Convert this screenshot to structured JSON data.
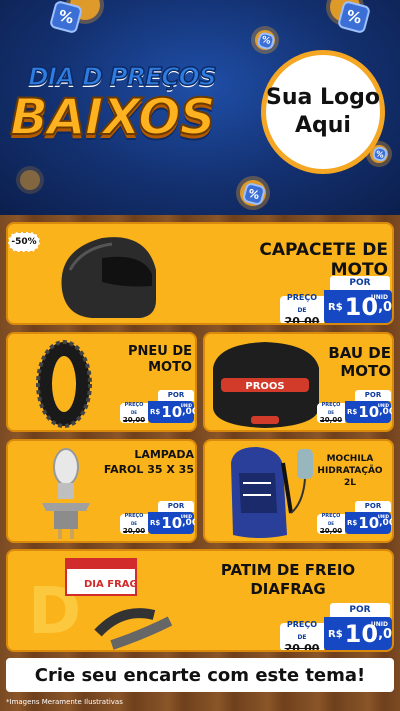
{
  "header": {
    "title_top": "DIA D PREÇOS",
    "title_main": "BAIXOS",
    "logo_line1": "Sua Logo",
    "logo_line2": "Aqui",
    "percent_symbol": "%"
  },
  "discount_badge": "-50%",
  "products": [
    {
      "name": "CAPACETE DE MOTO",
      "por": "POR",
      "preco_label": "PREÇO",
      "de_label": "DE",
      "old_price": "20,00",
      "currency": "R$",
      "int": "10",
      "cents": ",00",
      "unid": "UNID",
      "icon": "helmet-icon"
    },
    {
      "name": "PNEU DE MOTO",
      "por": "POR",
      "preco_label": "PREÇO",
      "de_label": "DE",
      "old_price": "20,00",
      "currency": "R$",
      "int": "10",
      "cents": ",00",
      "unid": "UNID",
      "icon": "tire-icon"
    },
    {
      "name": "BAU DE MOTO",
      "por": "POR",
      "preco_label": "PREÇO",
      "de_label": "DE",
      "old_price": "20,00",
      "currency": "R$",
      "int": "10",
      "cents": ",00",
      "unid": "UNID",
      "icon": "top-case-icon"
    },
    {
      "name": "LAMPADA FAROL 35 X 35",
      "por": "POR",
      "preco_label": "PREÇO",
      "de_label": "DE",
      "old_price": "20,00",
      "currency": "R$",
      "int": "10",
      "cents": ",00",
      "unid": "UNID",
      "icon": "bulb-icon"
    },
    {
      "name": "MOCHILA HIDRATAÇÃO 2L",
      "por": "POR",
      "preco_label": "PREÇO",
      "de_label": "DE",
      "old_price": "20,00",
      "currency": "R$",
      "int": "10",
      "cents": ",00",
      "unid": "UNID",
      "icon": "backpack-icon"
    },
    {
      "name": "PATIM DE FREIO DIAFRAG",
      "por": "POR",
      "preco_label": "PREÇO",
      "de_label": "DE",
      "old_price": "20,00",
      "currency": "R$",
      "int": "10",
      "cents": ",00",
      "unid": "UNID",
      "icon": "brake-shoe-icon"
    }
  ],
  "footer": {
    "cta": "Crie seu encarte com este tema!",
    "disclaimer": "*Imagens Meramente Ilustrativas"
  },
  "colors": {
    "card": "#fbb31c",
    "price_blue": "#1648c4",
    "header_blue": "#13306f",
    "accent": "#f5a623"
  }
}
